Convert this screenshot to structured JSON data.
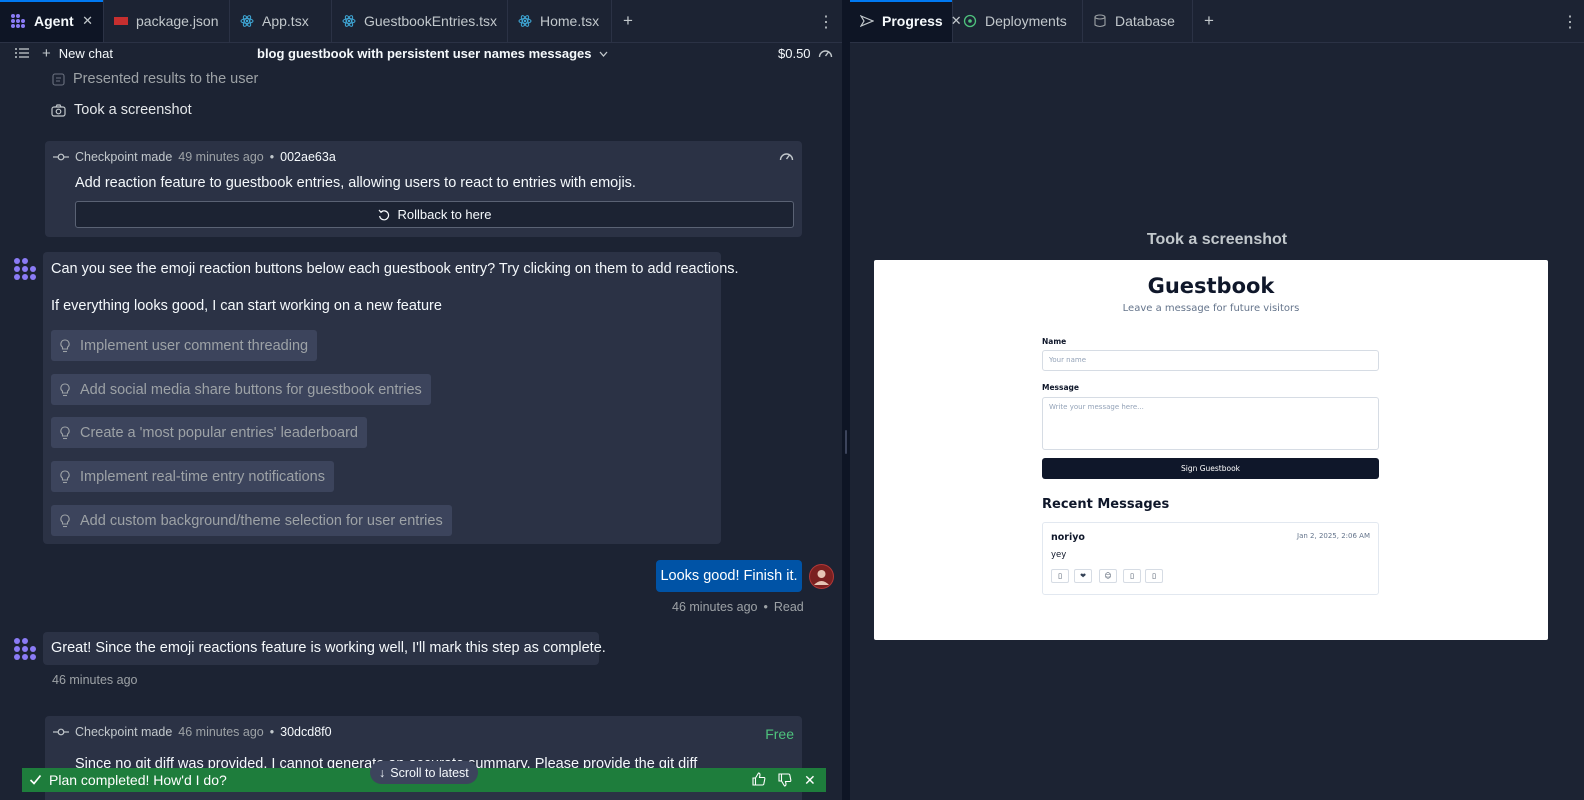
{
  "left_tabs": [
    {
      "label": "Agent",
      "icon": "agent-icon",
      "active": true
    },
    {
      "label": "package.json",
      "icon": "npm-icon"
    },
    {
      "label": "App.tsx",
      "icon": "react-icon"
    },
    {
      "label": "GuestbookEntries.tsx",
      "icon": "react-icon"
    },
    {
      "label": "Home.tsx",
      "icon": "react-icon"
    }
  ],
  "right_tabs": [
    {
      "label": "Progress",
      "icon": "progress-icon",
      "active": true
    },
    {
      "label": "Deployments",
      "icon": "deployments-icon"
    },
    {
      "label": "Database",
      "icon": "database-icon"
    }
  ],
  "subheader": {
    "new_chat": "New chat",
    "chat_title": "blog guestbook with persistent user names messages",
    "cost": "$0.50"
  },
  "feed": {
    "action_presented": "Presented results to the user",
    "action_screenshot": "Took a screenshot",
    "checkpoint1": {
      "label": "Checkpoint made",
      "time": "49 minutes ago",
      "sep": "•",
      "hash": "002ae63a",
      "description": "Add reaction feature to guestbook entries, allowing users to react to entries with emojis.",
      "rollback": "Rollback to here"
    },
    "agent_msg1": {
      "line1": "Can you see the emoji reaction buttons below each guestbook entry? Try clicking on them to add reactions.",
      "line2": "If everything looks good, I can start working on a new feature",
      "suggestions": [
        "Implement user comment threading",
        "Add social media share buttons for guestbook entries",
        "Create a 'most popular entries' leaderboard",
        "Implement real-time entry notifications",
        "Add custom background/theme selection for user entries"
      ]
    },
    "user_msg": {
      "text": "Looks good! Finish it.",
      "time": "46 minutes ago",
      "sep": "•",
      "status": "Read"
    },
    "agent_msg2": {
      "text": "Great! Since the emoji reactions feature is working well, I'll mark this step as complete.",
      "time": "46 minutes ago"
    },
    "checkpoint2": {
      "label": "Checkpoint made",
      "time": "46 minutes ago",
      "sep": "•",
      "hash": "30dcd8f0",
      "badge": "Free",
      "description": "Since no git diff was provided, I cannot generate an accurate summary. Please provide the git diff"
    }
  },
  "status_bar": {
    "text": "Plan completed! How'd I do?",
    "scroll_btn": "Scroll to latest"
  },
  "preview": {
    "title": "Took a screenshot",
    "app": {
      "heading": "Guestbook",
      "subtitle": "Leave a message for future visitors",
      "name_label": "Name",
      "name_placeholder": "Your name",
      "message_label": "Message",
      "message_placeholder": "Write your message here...",
      "submit": "Sign Guestbook",
      "recent_heading": "Recent Messages",
      "entry": {
        "author": "noriyo",
        "date": "Jan 2, 2025, 2:06 AM",
        "text": "yey",
        "reactions": [
          "▯",
          "❤",
          "☺",
          "▯",
          "▯"
        ]
      }
    }
  },
  "colors": {
    "accent": "#0079f2",
    "success": "#1e7d3c",
    "user_bubble": "#0053a6",
    "free_badge": "#4ec27d"
  }
}
